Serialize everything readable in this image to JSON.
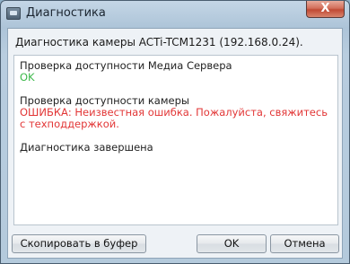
{
  "window": {
    "title": "Диагностика",
    "close_glyph": "X"
  },
  "header": {
    "subtitle": "Диагностика камеры ACTi-TCM1231 (192.168.0.24)."
  },
  "log": {
    "media_check": "Проверка доступности Медиа Сервера",
    "media_result": "OK",
    "camera_check": "Проверка доступности камеры",
    "camera_error": "ОШИБКА: Неизвестная ошибка. Пожалуйста, свяжитесь с техподдержкой.",
    "done": "Диагностика завершена"
  },
  "buttons": {
    "copy": "Скопировать в буфер",
    "ok": "OK",
    "cancel": "Отмена"
  },
  "colors": {
    "ok_text": "#3cb84a",
    "error_text": "#e23636",
    "close_button": "#c04a34"
  },
  "icons": {
    "app": "monitor-icon"
  }
}
